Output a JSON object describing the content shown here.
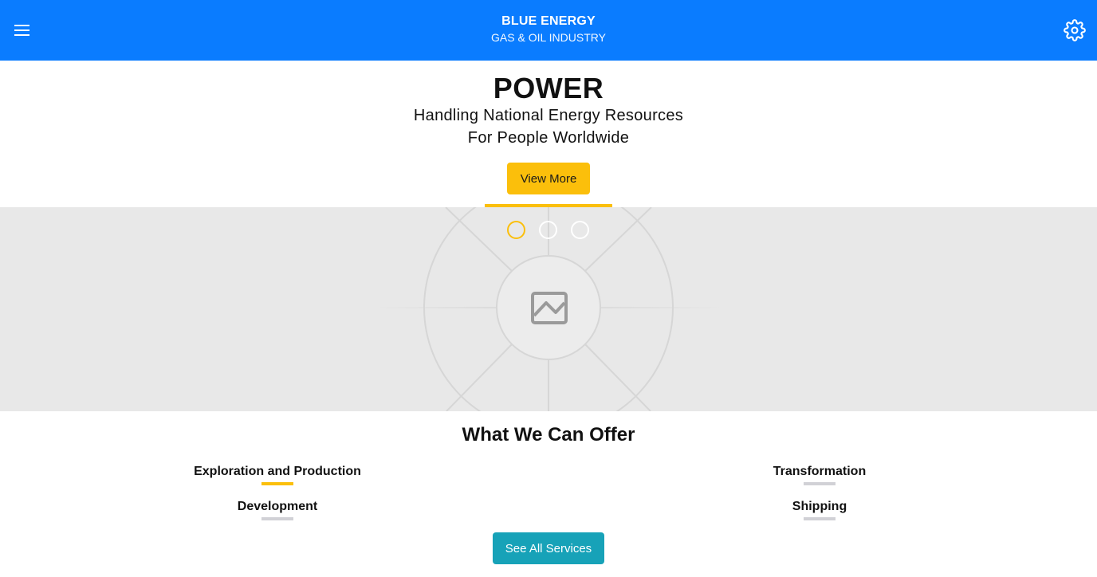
{
  "header": {
    "title": "BLUE ENERGY",
    "subtitle": "GAS & OIL INDUSTRY",
    "menu_icon": "hamburger-menu-icon",
    "settings_icon": "gear-icon",
    "bg_color": "#0a7cff"
  },
  "hero": {
    "title": "POWER",
    "line1": "Handling National Energy Resources",
    "line2": "For People Worldwide",
    "cta_label": "View More",
    "accent_color": "#fbbf0b"
  },
  "carousel": {
    "image_icon": "image-placeholder-icon",
    "slide_count": 3,
    "active_slide": 1
  },
  "services": {
    "title": "What We Can Offer",
    "items": [
      {
        "label": "Exploration and Production",
        "active": true
      },
      {
        "label": "Transformation",
        "active": false
      },
      {
        "label": "Development",
        "active": false
      },
      {
        "label": "Shipping",
        "active": false
      }
    ],
    "cta_label": "See All Services",
    "cta_color": "#17a2b8"
  }
}
